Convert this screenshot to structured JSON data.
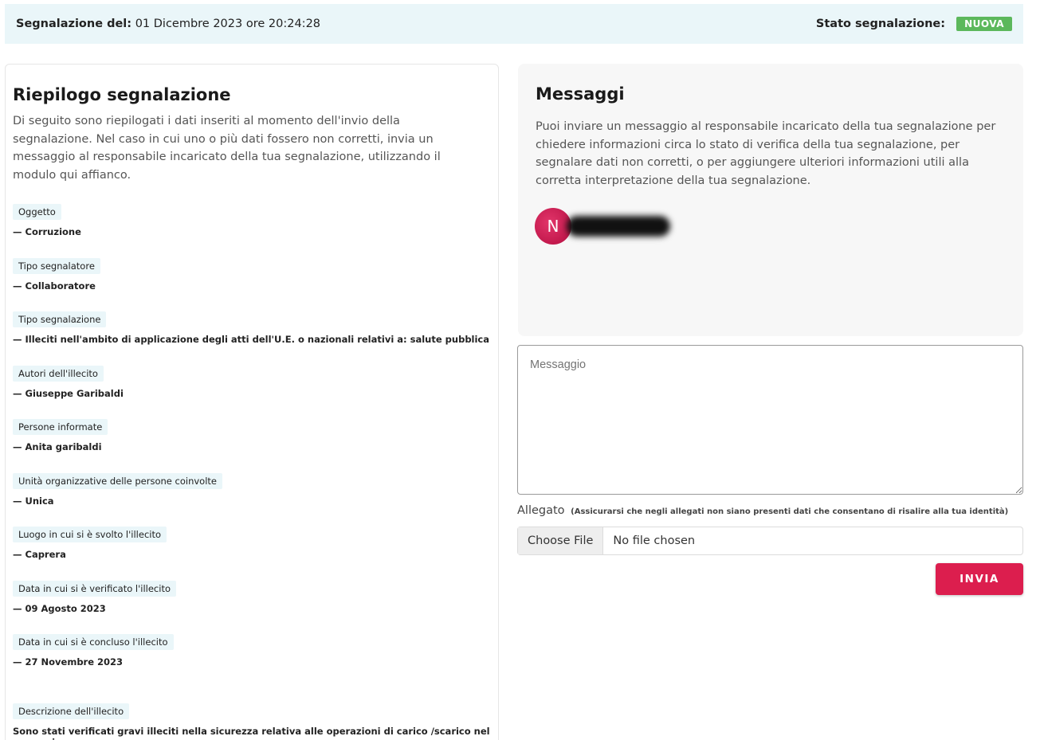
{
  "header": {
    "report_label": "Segnalazione del:",
    "report_date": "01 Dicembre 2023 ore 20:24:28",
    "status_label": "Stato segnalazione:",
    "status_value": "NUOVA",
    "status_color": "#5cb85c"
  },
  "summary": {
    "title": "Riepilogo segnalazione",
    "intro": "Di seguito sono riepilogati i dati inseriti al momento dell'invio della segnalazione. Nel caso in cui uno o più dati fossero non corretti, invia un messaggio al responsabile incaricato della tua segnalazione, utilizzando il modulo qui affianco.",
    "fields": [
      {
        "label": "Oggetto",
        "value": "— Corruzione"
      },
      {
        "label": "Tipo segnalatore",
        "value": "— Collaboratore"
      },
      {
        "label": "Tipo segnalazione",
        "value": "— Illeciti nell'ambito di applicazione degli atti dell'U.E. o nazionali relativi a: salute pubblica"
      },
      {
        "label": "Autori dell'illecito",
        "value": "— Giuseppe Garibaldi"
      },
      {
        "label": "Persone informate",
        "value": "— Anita garibaldi"
      },
      {
        "label": "Unità organizzative delle persone coinvolte",
        "value": "— Unica"
      },
      {
        "label": "Luogo in cui si è svolto l'illecito",
        "value": "— Caprera"
      },
      {
        "label": "Data in cui si è verificato l'illecito",
        "value": "— 09 Agosto 2023"
      },
      {
        "label": "Data in cui si è concluso l'illecito",
        "value": "— 27 Novembre 2023"
      },
      {
        "label": "Descrizione dell'illecito",
        "value": "Sono stati verificati gravi illeciti nella sicurezza relativa alle operazioni di carico /scarico nel magazzino"
      }
    ]
  },
  "messages": {
    "title": "Messaggi",
    "description": "Puoi inviare un messaggio al responsabile incaricato della tua segnalazione per chiedere informazioni circa lo stato di verifica della tua segnalazione, per segnalare dati non corretti, o per aggiungere ulteriori informazioni utili alla corretta interpretazione della tua segnalazione.",
    "avatar_initial": "N",
    "avatar_color": "#c8164b"
  },
  "form": {
    "message_placeholder": "Messaggio",
    "attachment_label": "Allegato",
    "attachment_note": "(Assicurarsi che negli allegati non siano presenti dati che consentano di risalire alla tua identità)",
    "choose_file_label": "Choose File",
    "no_file_text": "No file chosen",
    "send_label": "INVIA",
    "send_color": "#dc1e4e"
  }
}
